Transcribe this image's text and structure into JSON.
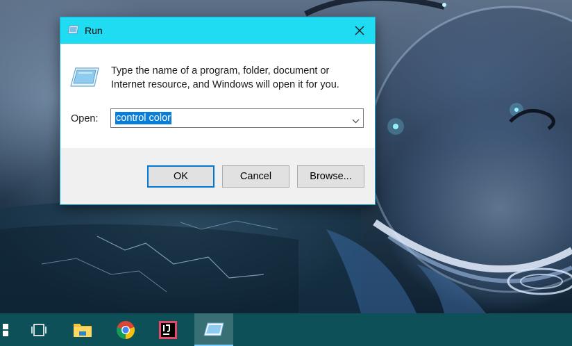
{
  "dialog": {
    "title": "Run",
    "description": "Type the name of a program, folder, document or Internet resource, and Windows will open it for you.",
    "open_label": "Open:",
    "open_value": "control color",
    "buttons": {
      "ok": "OK",
      "cancel": "Cancel",
      "browse": "Browse..."
    }
  },
  "taskbar": {
    "items": [
      "start-icon",
      "task-view-icon",
      "file-explorer-icon",
      "chrome-icon",
      "intellij-idea-icon",
      "run-app-icon"
    ],
    "active": "run-app-icon"
  },
  "colors": {
    "titlebar": "#1fdcf2",
    "taskbar": "#0d5057",
    "selection": "#0a7ed6",
    "default_button_border": "#0078d7"
  }
}
